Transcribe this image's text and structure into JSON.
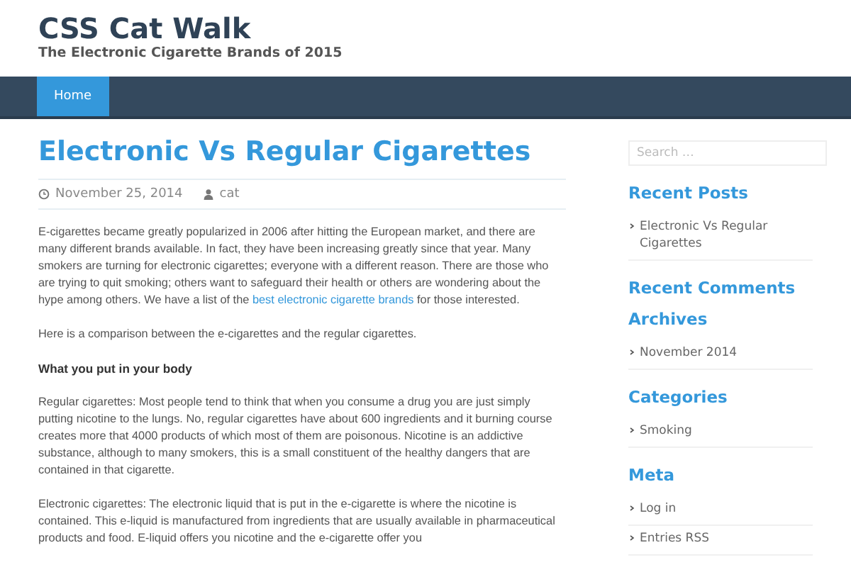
{
  "site": {
    "title": "CSS Cat Walk",
    "tagline": "The Electronic Cigarette Brands of 2015"
  },
  "nav": [
    {
      "label": "Home",
      "selected": true
    }
  ],
  "post": {
    "title": "Electronic Vs Regular Cigarettes",
    "date": "November 25, 2014",
    "author": "cat",
    "blocks": [
      {
        "kind": "paragraph",
        "text": "E-cigarettes became greatly popularized in 2006 after hitting the European market, and there are many different brands available. In fact, they have been increasing greatly since that year. Many smokers are turning for electronic cigarettes; everyone with a different reason. There are those who are trying to quit smoking; others want to safeguard their health or others are wondering about the hype among others. We have a list of the ",
        "link": "best electronic cigarette brands",
        "after": " for those interested."
      },
      {
        "kind": "paragraph",
        "text": "Here is a comparison between the e-cigarettes and the regular cigarettes."
      },
      {
        "kind": "heading",
        "text": "What you put in your body"
      },
      {
        "kind": "paragraph",
        "text": "Regular cigarettes: Most people tend to think that when you consume a drug you are just simply putting nicotine to the lungs. No, regular cigarettes have about 600 ingredients and it burning course creates more that 4000 products of which most of them are poisonous. Nicotine is an addictive substance, although to many smokers, this is a small constituent of the healthy dangers that are contained in that cigarette."
      },
      {
        "kind": "paragraph",
        "text": "Electronic cigarettes: The electronic liquid that is put in the e-cigarette is where the nicotine is contained. This e-liquid is manufactured from ingredients that are usually available in pharmaceutical products and food. E-liquid offers you nicotine and the e-cigarette offer you"
      }
    ]
  },
  "sidebar": {
    "search": {
      "placeholder": "Search …"
    },
    "widgets": [
      {
        "title": "Recent Posts",
        "items": [
          "Electronic Vs Regular Cigarettes"
        ]
      },
      {
        "title": "Recent Comments"
      },
      {
        "title": "Archives",
        "items": [
          "November 2014"
        ]
      },
      {
        "title": "Categories",
        "items": [
          "Smoking"
        ]
      },
      {
        "title": "Meta",
        "items": [
          "Log in",
          "Entries RSS"
        ]
      }
    ]
  }
}
